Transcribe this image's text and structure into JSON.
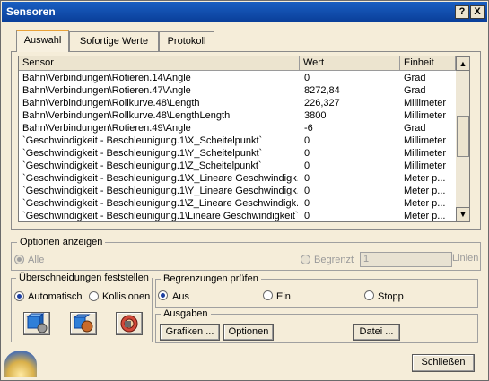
{
  "window": {
    "title": "Sensoren",
    "help_label": "?",
    "close_label": "X"
  },
  "tabs": [
    {
      "label": "Auswahl"
    },
    {
      "label": "Sofortige Werte"
    },
    {
      "label": "Protokoll"
    }
  ],
  "table": {
    "columns": {
      "sensor": "Sensor",
      "wert": "Wert",
      "einheit": "Einheit"
    },
    "rows": [
      {
        "sensor": "Bahn\\Verbindungen\\Rotieren.14\\Angle",
        "wert": "0",
        "einheit": "Grad"
      },
      {
        "sensor": "Bahn\\Verbindungen\\Rotieren.47\\Angle",
        "wert": "8272,84",
        "einheit": "Grad"
      },
      {
        "sensor": "Bahn\\Verbindungen\\Rollkurve.48\\Length",
        "wert": "226,327",
        "einheit": "Millimeter"
      },
      {
        "sensor": "Bahn\\Verbindungen\\Rollkurve.48\\LengthLength",
        "wert": "3800",
        "einheit": "Millimeter"
      },
      {
        "sensor": "Bahn\\Verbindungen\\Rotieren.49\\Angle",
        "wert": "-6",
        "einheit": "Grad"
      },
      {
        "sensor": "`Geschwindigkeit - Beschleunigung.1\\X_Scheitelpunkt`",
        "wert": "0",
        "einheit": "Millimeter"
      },
      {
        "sensor": "`Geschwindigkeit - Beschleunigung.1\\Y_Scheitelpunkt`",
        "wert": "0",
        "einheit": "Millimeter"
      },
      {
        "sensor": "`Geschwindigkeit - Beschleunigung.1\\Z_Scheitelpunkt`",
        "wert": "0",
        "einheit": "Millimeter"
      },
      {
        "sensor": "`Geschwindigkeit - Beschleunigung.1\\X_Lineare Geschwindigk...",
        "wert": "0",
        "einheit": "Meter p..."
      },
      {
        "sensor": "`Geschwindigkeit - Beschleunigung.1\\Y_Lineare Geschwindigk...",
        "wert": "0",
        "einheit": "Meter p..."
      },
      {
        "sensor": "`Geschwindigkeit - Beschleunigung.1\\Z_Lineare Geschwindigk...",
        "wert": "0",
        "einheit": "Meter p..."
      },
      {
        "sensor": "`Geschwindigkeit - Beschleunigung.1\\Lineare Geschwindigkeit`",
        "wert": "0",
        "einheit": "Meter p..."
      }
    ]
  },
  "optionen": {
    "legend": "Optionen anzeigen",
    "alle_label": "Alle",
    "begrenzt_label": "Begrenzt",
    "limit_value": "1",
    "limit_unit": "Linien"
  },
  "ueberschneidungen": {
    "legend": "Überschneidungen feststellen",
    "automatisch_label": "Automatisch",
    "kollisionen_label": "Kollisionen"
  },
  "begrenzungen": {
    "legend": "Begrenzungen prüfen",
    "aus_label": "Aus",
    "ein_label": "Ein",
    "stopp_label": "Stopp"
  },
  "ausgaben": {
    "legend": "Ausgaben",
    "grafiken_label": "Grafiken ...",
    "optionen_label": "Optionen",
    "datei_label": "Datei ..."
  },
  "close_button_label": "Schließen",
  "colors": {
    "title_bar": "#0a3f9a",
    "dialog_bg": "#f5edd9",
    "radio_selected": "#1d3fa0",
    "tab_highlight": "#e9a238"
  },
  "icons": [
    "interference-check-icon",
    "clash-detection-icon",
    "collision-target-icon"
  ]
}
